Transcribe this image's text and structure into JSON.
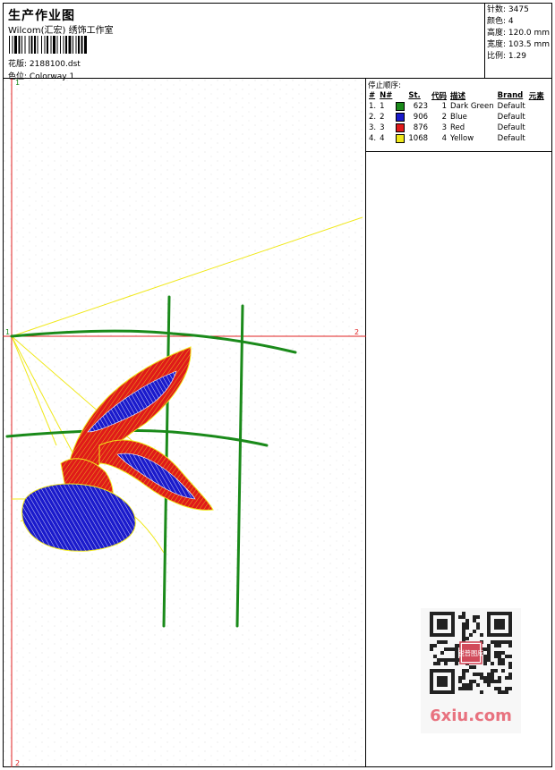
{
  "header": {
    "title": "生产作业图",
    "studio": "Wilcom(汇宏) 绣饰工作室",
    "design_label": "花版:",
    "design_value": "2188100.dst",
    "color_label": "色位:",
    "color_value": "Colorway 1"
  },
  "stats": {
    "stitches": "针数: 3475",
    "colors": "颜色: 4",
    "height": "高度: 120.0 mm",
    "width": "宽度: 103.5 mm",
    "scale": "比例: 1.29"
  },
  "stops": {
    "title": "停止顺序:",
    "columns": [
      "#",
      "N#",
      "St.",
      "代码",
      "描述",
      "Brand",
      "元素"
    ],
    "rows": [
      {
        "idx": "1.",
        "n": "1",
        "color": "#1a8a1a",
        "st": "623",
        "code": "1",
        "desc": "Dark Green",
        "brand": "Default"
      },
      {
        "idx": "2.",
        "n": "2",
        "color": "#1a1acc",
        "st": "906",
        "code": "2",
        "desc": "Blue",
        "brand": "Default"
      },
      {
        "idx": "3.",
        "n": "3",
        "color": "#e01a1a",
        "st": "876",
        "code": "3",
        "desc": "Red",
        "brand": "Default"
      },
      {
        "idx": "4.",
        "n": "4",
        "color": "#f0e81a",
        "st": "1068",
        "code": "4",
        "desc": "Yellow",
        "brand": "Default"
      }
    ]
  },
  "canvas": {
    "marker_top": "1",
    "marker_left": "1",
    "marker_right": "2",
    "marker_bottom": "2"
  },
  "watermark": {
    "text": "6xiu.com",
    "seal": "锐普图库"
  },
  "colors": {
    "green": "#1a8a1a",
    "blue": "#1a1acc",
    "red": "#e01a1a",
    "yellow": "#f0e81a",
    "guide_red": "#e02020"
  }
}
